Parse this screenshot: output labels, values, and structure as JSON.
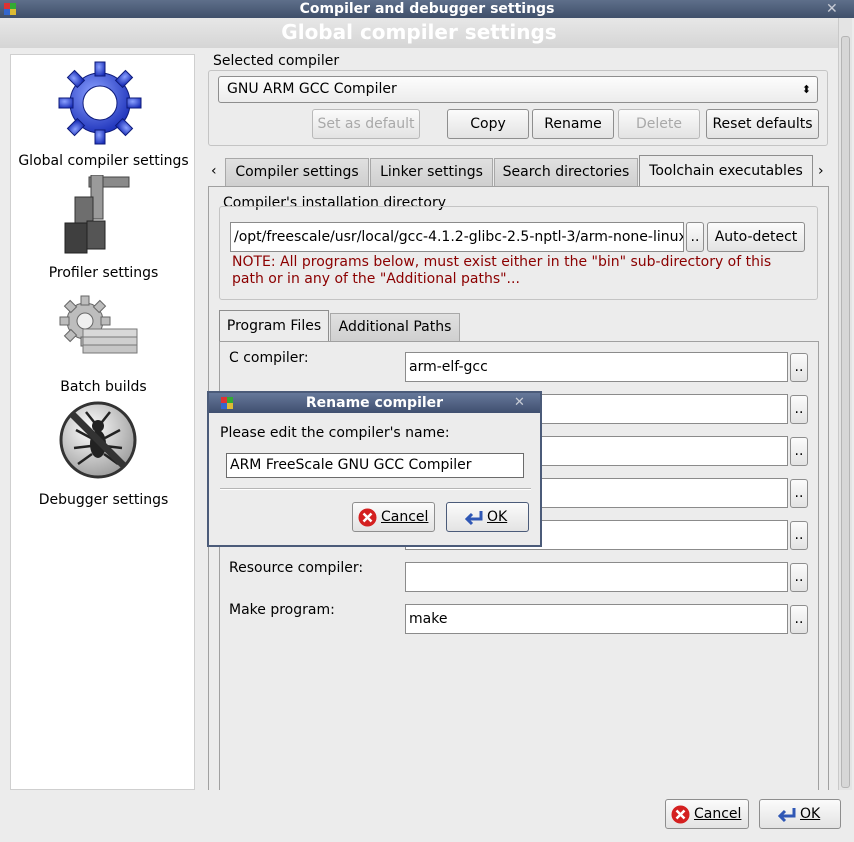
{
  "window": {
    "title": "Compiler and debugger settings",
    "header": "Global compiler settings"
  },
  "sidebar": {
    "items": [
      {
        "label": "Global compiler settings",
        "icon": "gear-icon"
      },
      {
        "label": "Profiler settings",
        "icon": "caliper-icon"
      },
      {
        "label": "Batch builds",
        "icon": "batch-gears-icon"
      },
      {
        "label": "Debugger settings",
        "icon": "no-bug-icon"
      }
    ]
  },
  "compiler": {
    "group_label": "Selected compiler",
    "selected": "GNU ARM GCC Compiler",
    "buttons": {
      "set_default": "Set as default",
      "copy": "Copy",
      "rename": "Rename",
      "delete": "Delete",
      "reset": "Reset defaults"
    }
  },
  "tabs": [
    "Compiler settings",
    "Linker settings",
    "Search directories",
    "Toolchain executables"
  ],
  "install": {
    "group_label": "Compiler's installation directory",
    "path": "/opt/freescale/usr/local/gcc-4.1.2-glibc-2.5-nptl-3/arm-none-linux",
    "browse": "..",
    "autodetect": "Auto-detect",
    "note": "NOTE: All programs below, must exist either in the \"bin\" sub-directory of this path or in any of the \"Additional paths\"..."
  },
  "subtabs": [
    "Program Files",
    "Additional Paths"
  ],
  "programs": [
    {
      "label": "C compiler:",
      "value": "arm-elf-gcc"
    },
    {
      "label": "",
      "value": ""
    },
    {
      "label": "",
      "value": ""
    },
    {
      "label": "",
      "value": ""
    },
    {
      "label": "",
      "value": ""
    },
    {
      "label": "Resource compiler:",
      "value": ""
    },
    {
      "label": "Make program:",
      "value": "make"
    }
  ],
  "browse_label": "..",
  "footer": {
    "cancel": "Cancel",
    "ok": "OK"
  },
  "dialog": {
    "title": "Rename compiler",
    "prompt": "Please edit the compiler's name:",
    "value": "ARM FreeScale GNU GCC Compiler",
    "cancel": "Cancel",
    "ok": "OK"
  },
  "colors": {
    "note": "#8b0000",
    "titlebar": "#4b5b79",
    "cancel_icon": "#d42020"
  }
}
